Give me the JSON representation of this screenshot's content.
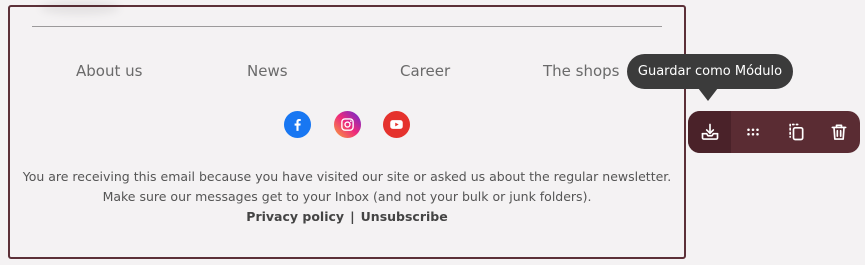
{
  "footer": {
    "nav_links": [
      "About us",
      "News",
      "Career",
      "The shops"
    ],
    "social_icons": [
      "facebook-icon",
      "instagram-icon",
      "youtube-icon"
    ],
    "notice_line1": "You are receiving this email because you have visited our site or asked us about the regular newsletter.",
    "notice_line2": "Make sure our messages get to your Inbox (and not your bulk or junk folders).",
    "privacy_label": "Privacy policy",
    "separator": "|",
    "unsubscribe_label": "Unsubscribe"
  },
  "toolbar": {
    "tooltip": "Guardar como Módulo",
    "buttons": [
      "save-module-icon",
      "drag-handle-icon",
      "duplicate-icon",
      "trash-icon"
    ]
  },
  "colors": {
    "frame_border": "#5c3038",
    "toolbar_bg": "#5a2c33",
    "tooltip_bg": "#3b3b3b",
    "facebook": "#1877f2",
    "youtube": "#e5322d"
  }
}
